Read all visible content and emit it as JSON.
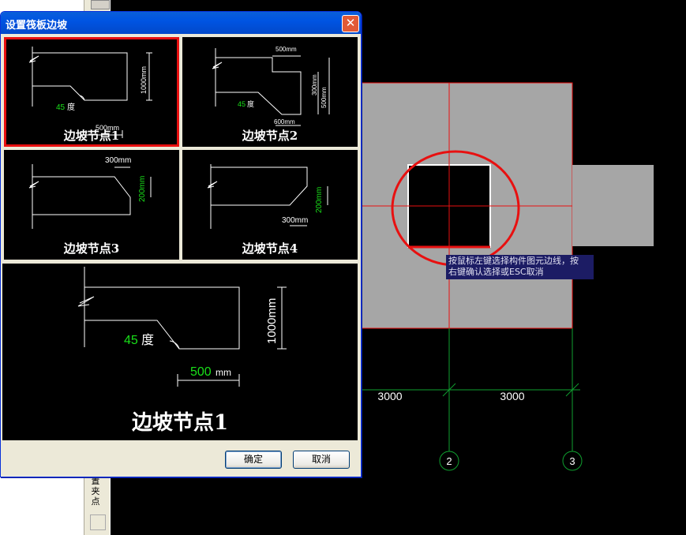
{
  "dialog": {
    "title": "设置筏板边坡",
    "close_glyph": "✕",
    "nodes": [
      {
        "label": "边坡节点1",
        "dims": {
          "v": "1000mm",
          "h": "500mm",
          "angle_num": "45",
          "angle_unit": "度"
        }
      },
      {
        "label": "边坡节点2",
        "dims": {
          "top": "500mm",
          "bottom": "600mm",
          "v1": "300mm",
          "v2": "500mm",
          "angle_num": "45",
          "angle_unit": "度"
        }
      },
      {
        "label": "边坡节点3",
        "dims": {
          "top": "300mm",
          "v": "200mm"
        }
      },
      {
        "label": "边坡节点4",
        "dims": {
          "bottom": "300mm",
          "v": "200mm"
        }
      }
    ],
    "preview": {
      "label": "边坡节点1",
      "v": "1000mm",
      "h_num": "500",
      "h_unit": "mm",
      "angle_num": "45",
      "angle_unit": "度"
    },
    "ok_label": "确定",
    "cancel_label": "取消"
  },
  "sidebar": {
    "text1": "置",
    "text2": "夹",
    "text3": "点"
  },
  "cad": {
    "dim_left": "3000",
    "dim_right": "3000",
    "axis_2": "2",
    "axis_3": "3",
    "tooltip_line1": "按鼠标左键选择构件图元边线，按",
    "tooltip_line2": "右键确认选择或ESC取消",
    "colors": {
      "slab": "#a6a6a6",
      "axis": "#e81010",
      "grid": "#0f9f2f",
      "highlight": "#e81010"
    }
  }
}
